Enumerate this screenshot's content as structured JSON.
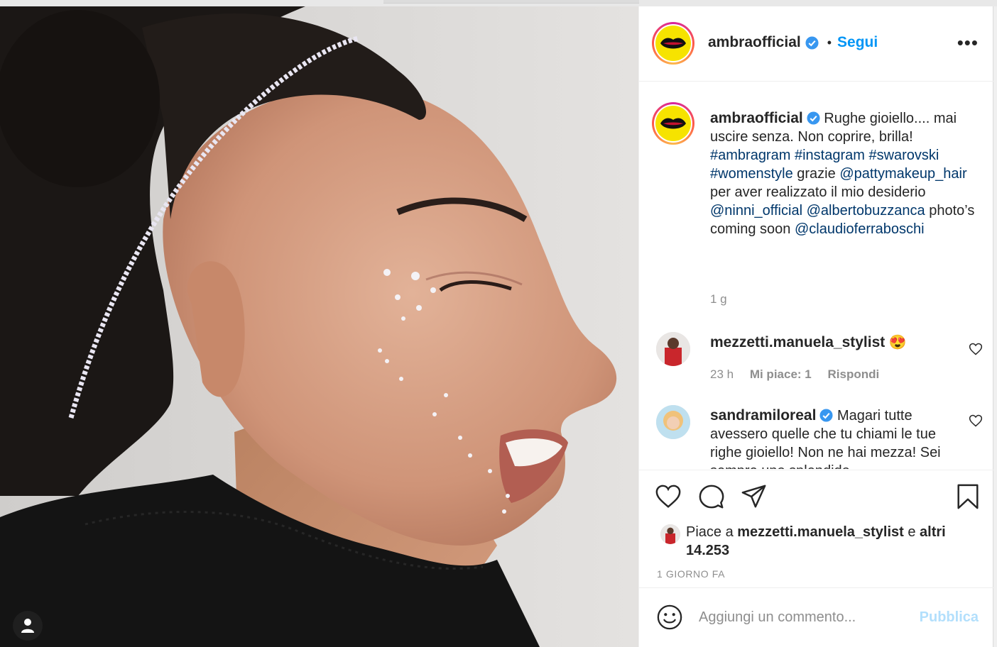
{
  "colors": {
    "accent": "#0095f6",
    "hashtag": "#00376b",
    "muted": "#8e8e8e",
    "publish_disabled": "#b2dffc",
    "logo_yellow": "#f6e300"
  },
  "photo": {
    "user_tag_icon": "person-icon"
  },
  "header": {
    "username": "ambraofficial",
    "verified_icon": "verified-badge-icon",
    "separator": "•",
    "follow_label": "Segui",
    "more_label": "•••"
  },
  "caption": {
    "username": "ambraofficial",
    "text_1": " Rughe gioiello.... mai uscire senza. Non coprire, brilla! ",
    "hashtags": [
      "#ambragram",
      "#instagram",
      "#swarovski",
      "#womenstyle"
    ],
    "text_2": " grazie ",
    "mention_1": "@pattymakeup_hair",
    "text_3": " per aver realizzato il mio desiderio ",
    "mention_2": "@ninni_official",
    "mention_3": "@albertobuzzanca",
    "text_4": " photo’s coming soon ",
    "mention_4": "@claudioferraboschi",
    "time": "1 g"
  },
  "comments": [
    {
      "username": "mezzetti.manuela_stylist",
      "text": " 😍",
      "time": "23 h",
      "likes": "Mi piace: 1",
      "reply": "Rispondi"
    },
    {
      "username": "sandramiloreal",
      "text": " Magari tutte avessero quelle che tu chiami le tue righe gioiello! Non ne hai mezza! Sei sempre uno splendido"
    }
  ],
  "actions": {
    "like_icon": "heart-icon",
    "comment_icon": "comment-icon",
    "share_icon": "send-icon",
    "save_icon": "bookmark-icon"
  },
  "likes": {
    "prefix": "Piace a ",
    "username": "mezzetti.manuela_stylist",
    "mid": " e ",
    "others": "altri 14.253"
  },
  "date": "1 GIORNO FA",
  "add_comment": {
    "placeholder": "Aggiungi un commento...",
    "publish_label": "Pubblica",
    "emoji_icon": "smiley-icon"
  }
}
